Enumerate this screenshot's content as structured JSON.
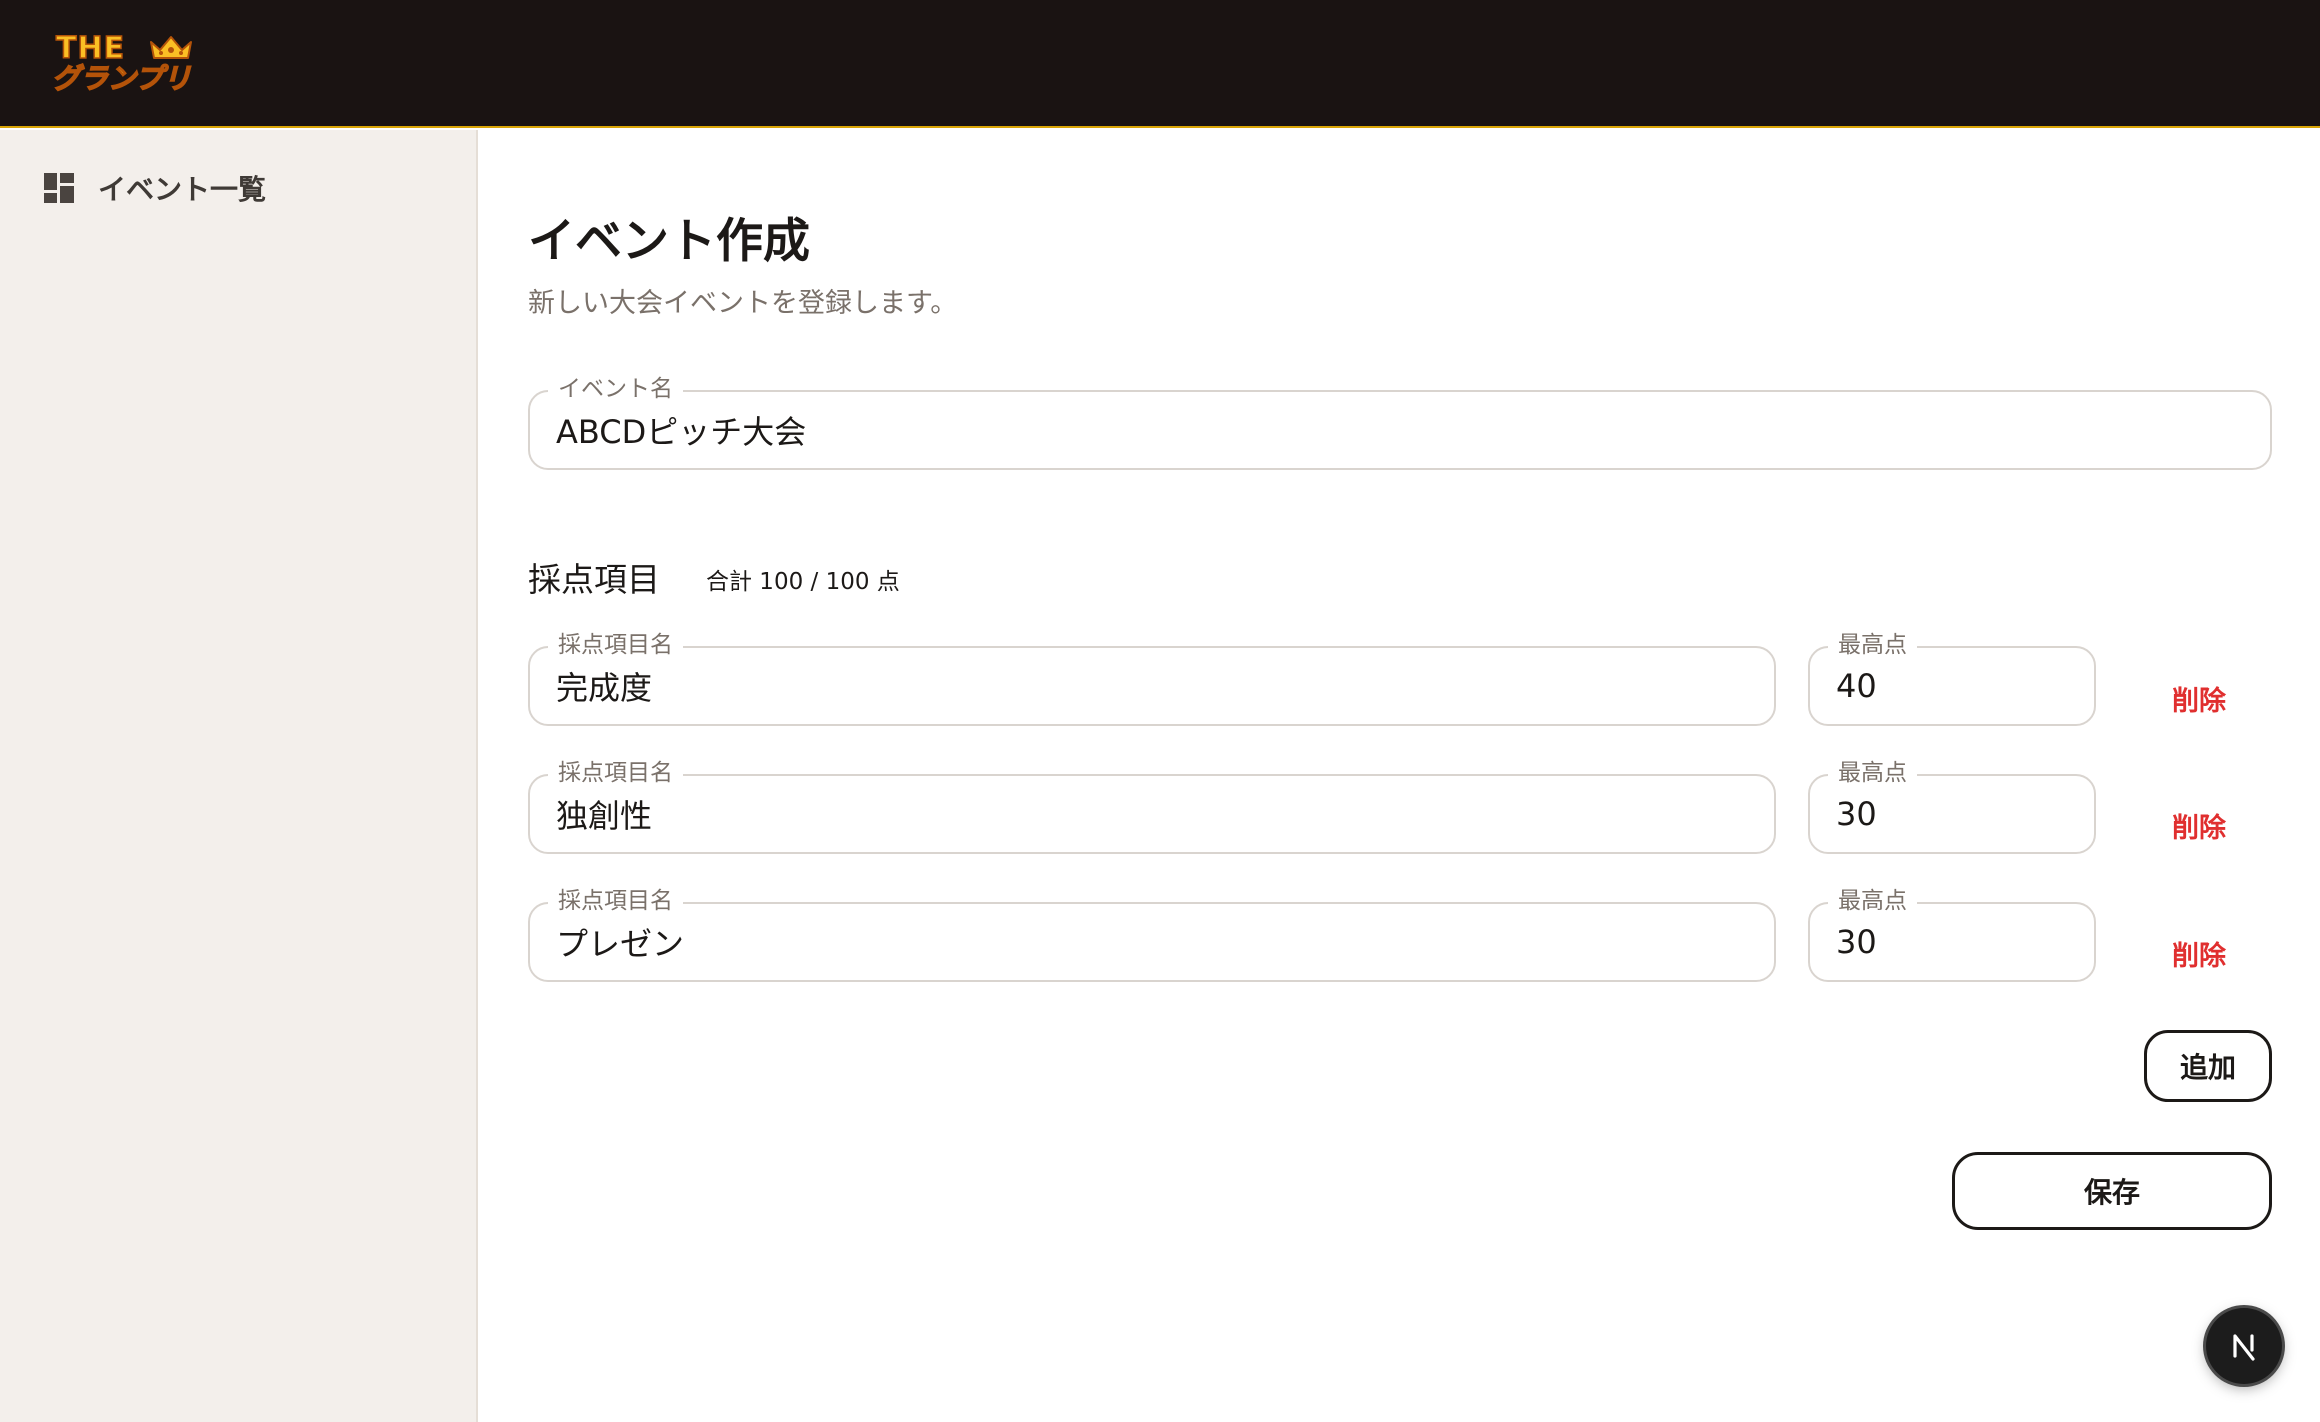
{
  "header": {
    "logo_top": "THE",
    "logo_main": "グランプリ",
    "accent_color": "#fbbf24",
    "background_color": "#1a1312"
  },
  "sidebar": {
    "items": [
      {
        "label": "イベント一覧",
        "icon": "dashboard-icon"
      }
    ]
  },
  "main": {
    "title": "イベント作成",
    "subtitle": "新しい大会イベントを登録します。",
    "event_name": {
      "label": "イベント名",
      "value": "ABCDピッチ大会"
    },
    "scoring": {
      "title": "採点項目",
      "total": "合計 100 / 100 点",
      "items": [
        {
          "name_label": "採点項目名",
          "name": "完成度",
          "max_label": "最高点",
          "max": "40",
          "delete_label": "削除"
        },
        {
          "name_label": "採点項目名",
          "name": "独創性",
          "max_label": "最高点",
          "max": "30",
          "delete_label": "削除"
        },
        {
          "name_label": "採点項目名",
          "name": "プレゼン",
          "max_label": "最高点",
          "max": "30",
          "delete_label": "削除"
        }
      ],
      "add_label": "追加"
    },
    "save_label": "保存"
  },
  "dev_badge": {
    "label": "N",
    "icon": "nextjs-icon"
  },
  "colors": {
    "danger": "#e02f2f",
    "sidebar_bg": "#f3efeb",
    "border": "#d9d4cf",
    "muted_text": "#7a716a"
  }
}
